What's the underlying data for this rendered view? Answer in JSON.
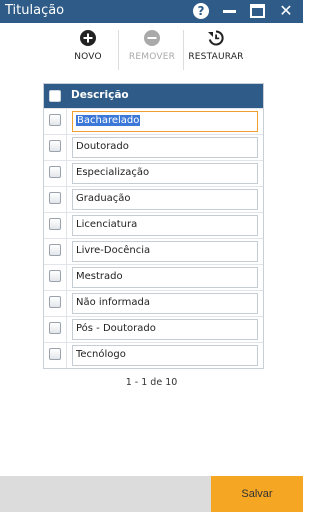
{
  "window": {
    "title": "Titulação",
    "help_glyph": "?",
    "close_glyph": "✕"
  },
  "toolbar": {
    "novo_label": "NOVO",
    "remover_label": "REMOVER",
    "restaurar_label": "RESTAURAR",
    "novo_icon": "plus-circle-icon",
    "remover_icon": "minus-circle-icon",
    "restaurar_icon": "restore-history-icon",
    "remover_disabled": true
  },
  "grid": {
    "header": {
      "descricao": "Descrição"
    },
    "rows": [
      {
        "descricao": "Bacharelado",
        "editing": true
      },
      {
        "descricao": "Doutorado"
      },
      {
        "descricao": "Especialização"
      },
      {
        "descricao": "Graduação"
      },
      {
        "descricao": "Licenciatura"
      },
      {
        "descricao": "Livre-Docência"
      },
      {
        "descricao": "Mestrado"
      },
      {
        "descricao": "Não informada"
      },
      {
        "descricao": "Pós - Doutorado"
      },
      {
        "descricao": "Tecnólogo"
      }
    ]
  },
  "pager": {
    "text": "1 - 1 de 10"
  },
  "footer": {
    "save_label": "Salvar"
  },
  "colors": {
    "header_blue": "#2e5b87",
    "save_orange": "#f5a623",
    "footer_gray": "#dcdcdc",
    "selection_blue": "#3b78d8",
    "edit_border_orange": "#f0a030",
    "disabled_gray": "#a9a9a9"
  }
}
